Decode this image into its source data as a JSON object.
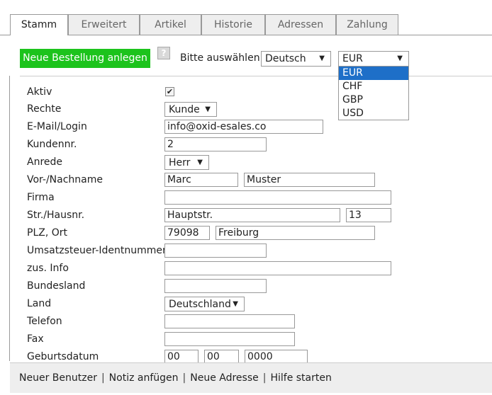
{
  "tabs": [
    "Stamm",
    "Erweitert",
    "Artikel",
    "Historie",
    "Adressen",
    "Zahlung"
  ],
  "toolbar": {
    "new_order_label": "Neue Bestellung anlegen",
    "help_label": "?",
    "choose_label": "Bitte auswählen",
    "language_value": "Deutsch",
    "currency_value": "EUR",
    "currency_options": [
      "EUR",
      "CHF",
      "GBP",
      "USD"
    ]
  },
  "form": {
    "active": {
      "label": "Aktiv",
      "checked": true
    },
    "rights": {
      "label": "Rechte",
      "value": "Kunde"
    },
    "email": {
      "label": "E-Mail/Login",
      "value": "info@oxid-esales.co"
    },
    "customer_no": {
      "label": "Kundennr.",
      "value": "2"
    },
    "salutation": {
      "label": "Anrede",
      "value": "Herr"
    },
    "name": {
      "label": "Vor-/Nachname",
      "first": "Marc",
      "last": "Muster"
    },
    "company": {
      "label": "Firma",
      "value": ""
    },
    "street": {
      "label": "Str./Hausnr.",
      "street": "Hauptstr.",
      "number": "13"
    },
    "zip_city": {
      "label": "PLZ, Ort",
      "zip": "79098",
      "city": "Freiburg"
    },
    "vat_id": {
      "label": "Umsatzsteuer-Identnummer",
      "value": ""
    },
    "add_info": {
      "label": "zus. Info",
      "value": ""
    },
    "state": {
      "label": "Bundesland",
      "value": ""
    },
    "country": {
      "label": "Land",
      "value": "Deutschland"
    },
    "phone": {
      "label": "Telefon",
      "value": ""
    },
    "fax": {
      "label": "Fax",
      "value": ""
    },
    "birthdate": {
      "label": "Geburtsdatum",
      "day": "00",
      "month": "00",
      "year": "0000"
    }
  },
  "footer": {
    "links": [
      "Neuer Benutzer",
      "Notiz anfügen",
      "Neue Adresse",
      "Hilfe starten"
    ],
    "separator": "|"
  },
  "colors": {
    "new_order_button": "#1cc31c",
    "dropdown_highlight": "#1e6fc8"
  }
}
